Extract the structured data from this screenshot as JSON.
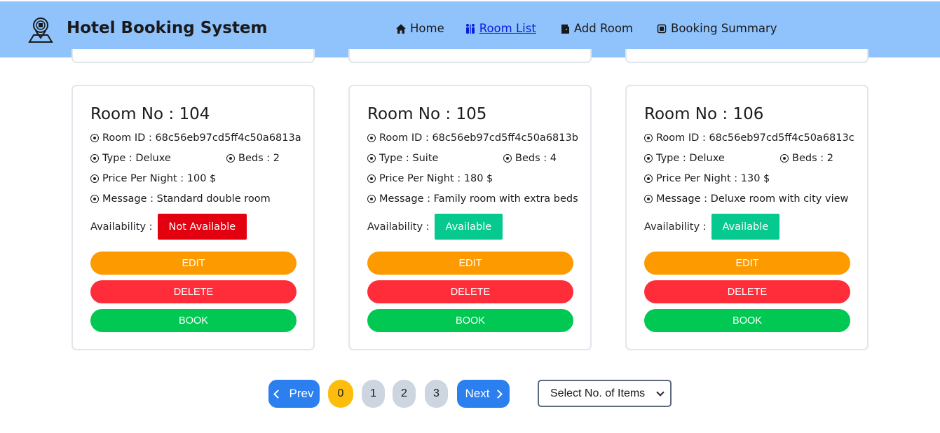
{
  "header": {
    "title": "Hotel Booking System",
    "logo_icon": "hotel-location-icon",
    "nav": [
      {
        "label": "Home",
        "icon": "home-icon",
        "active": false
      },
      {
        "label": "Room List",
        "icon": "people-icon",
        "active": true
      },
      {
        "label": "Add Room",
        "icon": "door-icon",
        "active": false
      },
      {
        "label": "Booking Summary",
        "icon": "summary-icon",
        "active": false
      }
    ]
  },
  "labels": {
    "availability": "Availability :",
    "edit": "EDIT",
    "delete": "DELETE",
    "book": "BOOK"
  },
  "rooms": [
    {
      "title": "Room No : 104",
      "room_id": "Room ID : 68c56eb97cd5ff4c50a6813a",
      "type": "Type : Deluxe",
      "beds": "Beds : 2",
      "price": "Price Per Night : 100 $",
      "message": "Message : Standard double room",
      "availability": "Not Available",
      "availability_color": "#e3000f"
    },
    {
      "title": "Room No : 105",
      "room_id": "Room ID : 68c56eb97cd5ff4c50a6813b",
      "type": "Type : Suite",
      "beds": "Beds : 4",
      "price": "Price Per Night : 180 $",
      "message": "Message : Family room with extra beds",
      "availability": "Available",
      "availability_color": "#05c98e"
    },
    {
      "title": "Room No : 106",
      "room_id": "Room ID : 68c56eb97cd5ff4c50a6813c",
      "type": "Type : Deluxe",
      "beds": "Beds : 2",
      "price": "Price Per Night : 130 $",
      "message": "Message : Deluxe room with city view",
      "availability": "Available",
      "availability_color": "#05c98e"
    }
  ],
  "pagination": {
    "prev": "Prev",
    "next": "Next",
    "pages": [
      "0",
      "1",
      "2",
      "3"
    ],
    "active_page": "0"
  },
  "items_select": {
    "value": "Select No. of Items"
  },
  "colors": {
    "navbar": "#90c2fb",
    "edit": "#fd9a00",
    "delete": "#ff2d3a",
    "book": "#00c853",
    "page_active": "#fcbd0d",
    "page_nav": "#2b7fef"
  }
}
